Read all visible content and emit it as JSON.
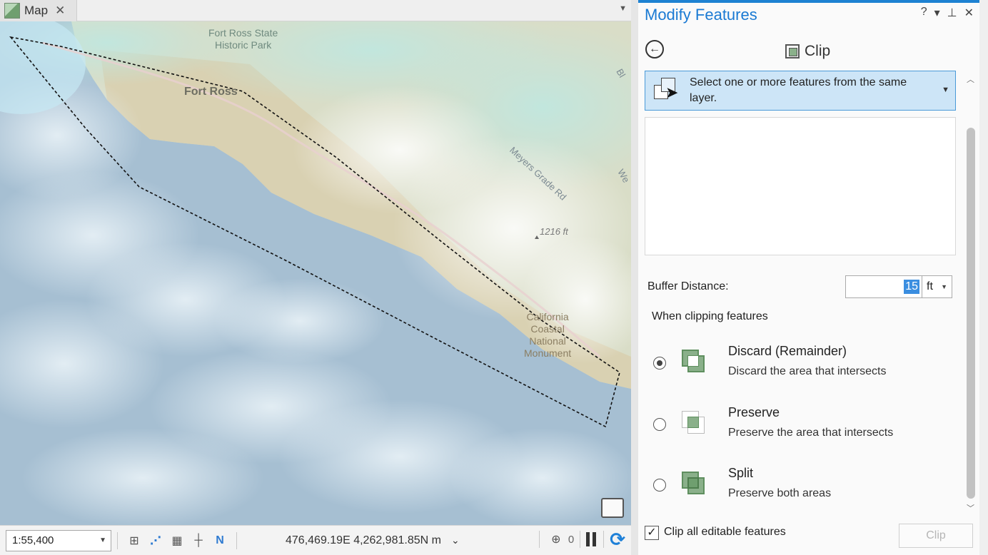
{
  "map": {
    "tab_label": "Map",
    "tab_close": "✕",
    "labels": {
      "park": "Fort Ross State\nHistoric Park",
      "town": "Fort Ross",
      "road": "Meyers Grade Rd",
      "elevation": "1216 ft",
      "monument": "California\nCoastal\nNational\nMonument",
      "edge_top": "Bl",
      "edge_mid": "We"
    },
    "status": {
      "scale": "1:55,400",
      "coordinates": "476,469.19E 4,262,981.85N m",
      "selected_count": "0"
    }
  },
  "panel": {
    "title": "Modify Features",
    "tools": {
      "help": "?",
      "menu": "▾",
      "pin": "⊥",
      "close": "✕"
    },
    "tool_name": "Clip",
    "select_prompt": "Select one or more features from the same layer.",
    "buffer_label": "Buffer Distance:",
    "buffer_value": "15",
    "buffer_unit": "ft",
    "when_clipping_label": "When clipping features",
    "options": [
      {
        "title": "Discard (Remainder)",
        "desc": "Discard the area that intersects",
        "selected": true
      },
      {
        "title": "Preserve",
        "desc": "Preserve the area that intersects",
        "selected": false
      },
      {
        "title": "Split",
        "desc": "Preserve both areas",
        "selected": false
      }
    ],
    "clip_all_label": "Clip all editable features",
    "clip_all_checked": true,
    "clip_button": "Clip"
  },
  "icons": {
    "map_tab": "map-icon",
    "back": "back-arrow-icon",
    "clip": "clip-tool-icon",
    "select": "select-features-icon",
    "refresh": "refresh-icon",
    "pause": "pause-icon"
  },
  "colors": {
    "accent": "#1e82d2",
    "select_box": "#cde5f7",
    "green_icon": "#8ab08a"
  }
}
